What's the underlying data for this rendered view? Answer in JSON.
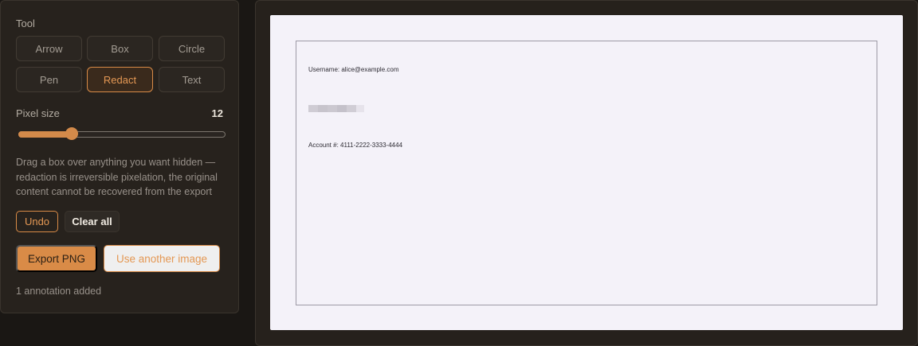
{
  "sidebar": {
    "tool_label": "Tool",
    "tools": [
      {
        "label": "Arrow",
        "active": false
      },
      {
        "label": "Box",
        "active": false
      },
      {
        "label": "Circle",
        "active": false
      },
      {
        "label": "Pen",
        "active": false
      },
      {
        "label": "Redact",
        "active": true
      },
      {
        "label": "Text",
        "active": false
      }
    ],
    "pixel_size_label": "Pixel size",
    "pixel_size_value": "12",
    "slider_fraction": 0.24,
    "hint": "Drag a box over anything you want hidden — redaction is irreversible pixelation, the original content cannot be recovered from the export",
    "undo_label": "Undo",
    "clear_label": "Clear all",
    "export_label": "Export PNG",
    "another_label": "Use another image",
    "status": "1 annotation added"
  },
  "canvas": {
    "username_line": "Username: alice@example.com",
    "account_line": "Account #: 4111-2222-3333-4444"
  },
  "colors": {
    "accent": "#d98b47",
    "canvas_bg": "#f4f2f9"
  }
}
